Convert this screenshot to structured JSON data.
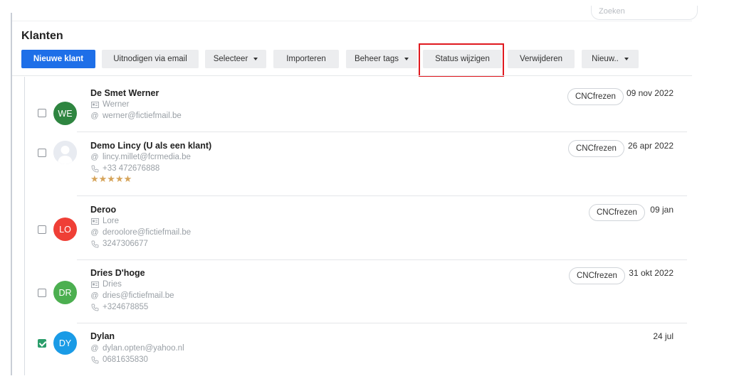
{
  "search": {
    "placeholder": "Zoeken"
  },
  "page": {
    "title": "Klanten"
  },
  "toolbar": {
    "new_customer": "Nieuwe klant",
    "invite_email": "Uitnodigen via email",
    "select": "Selecteer",
    "import": "Importeren",
    "manage_tags": "Beheer tags",
    "change_status": "Status wijzigen",
    "delete": "Verwijderen",
    "new_more": "Nieuw.."
  },
  "colors": {
    "primary": "#1e6fe8",
    "highlight": "#e0191f",
    "checked": "#2a9d6a",
    "star": "#d6a45a"
  },
  "customers": [
    {
      "name": "De Smet Werner",
      "initials": "WE",
      "avatar_color": "#2e8540",
      "contact": "Werner",
      "email": "werner@fictiefmail.be",
      "tag": "CNCfrezen",
      "date": "09 nov 2022",
      "checked": false
    },
    {
      "name": "Demo Lincy (U als een klant)",
      "email": "lincy.millet@fcrmedia.be",
      "phone": "+33 472676888",
      "rating": 5,
      "rating_text": "★★★★★",
      "tag": "CNCfrezen",
      "date": "26 apr 2022",
      "checked": false
    },
    {
      "name": "Deroo",
      "initials": "LO",
      "avatar_color": "#ef3f36",
      "contact": "Lore",
      "email": "deroolore@fictiefmail.be",
      "phone": "3247306677",
      "tag": "CNCfrezen",
      "date": "09 jan",
      "checked": false
    },
    {
      "name": "Dries D'hoge",
      "initials": "DR",
      "avatar_color": "#4caf50",
      "contact": "Dries",
      "email": "dries@fictiefmail.be",
      "phone": "+324678855",
      "tag": "CNCfrezen",
      "date": "31 okt 2022",
      "checked": false
    },
    {
      "name": "Dylan",
      "initials": "DY",
      "avatar_color": "#1a9be6",
      "email": "dylan.opten@yahoo.nl",
      "phone": "0681635830",
      "date": "24 jul",
      "checked": true
    }
  ]
}
